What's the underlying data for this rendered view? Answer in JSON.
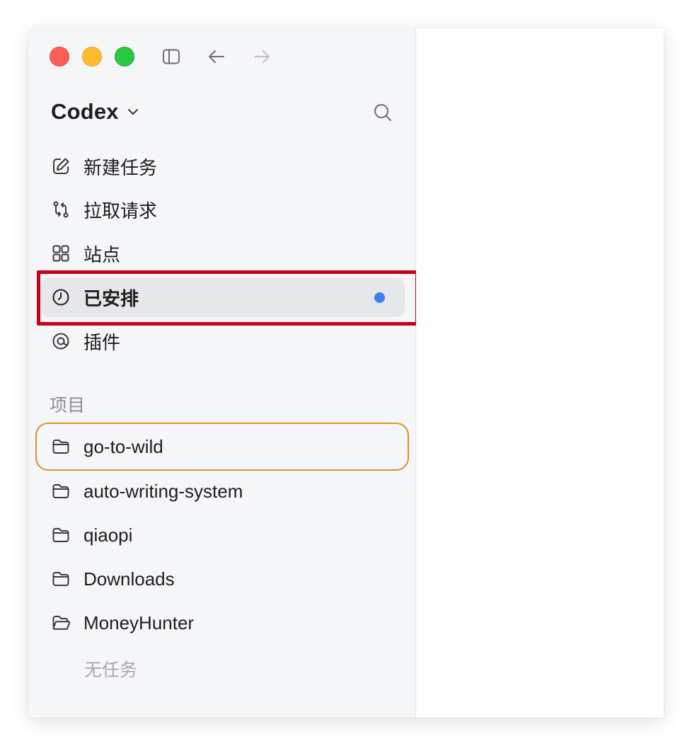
{
  "app": {
    "title": "Codex"
  },
  "nav": [
    {
      "label": "新建任务",
      "icon": "edit-icon"
    },
    {
      "label": "拉取请求",
      "icon": "pull-request-icon"
    },
    {
      "label": "站点",
      "icon": "grid-icon"
    },
    {
      "label": "已安排",
      "icon": "clock-icon",
      "active": true,
      "has_unread_dot": true
    },
    {
      "label": "插件",
      "icon": "plugin-icon"
    }
  ],
  "projects_section": {
    "label": "项目",
    "items": [
      {
        "label": "go-to-wild",
        "icon": "folder-icon",
        "focused": true
      },
      {
        "label": "auto-writing-system",
        "icon": "folder-icon"
      },
      {
        "label": "qiaopi",
        "icon": "folder-icon"
      },
      {
        "label": "Downloads",
        "icon": "folder-icon"
      },
      {
        "label": "MoneyHunter",
        "icon": "folder-open-icon",
        "expanded": true
      }
    ],
    "empty_label": "无任务"
  },
  "colors": {
    "accent_dot": "#3b82f6",
    "highlight_border": "#c4001a",
    "focus_border": "#d9922a",
    "sidebar_bg": "#f5f6f7"
  }
}
